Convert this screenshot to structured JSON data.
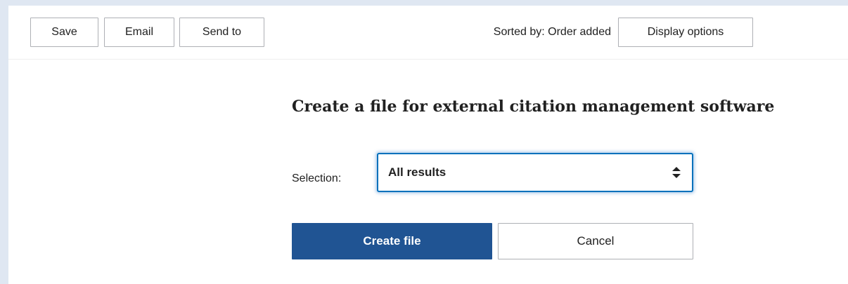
{
  "toolbar": {
    "save_label": "Save",
    "email_label": "Email",
    "sendto_label": "Send to",
    "sorted_text": "Sorted by: Order added",
    "display_options_label": "Display options"
  },
  "citation_form": {
    "heading": "Create a file for external citation management software",
    "selection_label": "Selection:",
    "selection_value": "All results",
    "selection_icon": "updown-arrows-icon",
    "create_label": "Create file",
    "cancel_label": "Cancel"
  },
  "colors": {
    "background": "#dfe7f2",
    "primary_button": "#205493",
    "select_focus": "#0071bc",
    "button_border": "#aeb0b5"
  }
}
